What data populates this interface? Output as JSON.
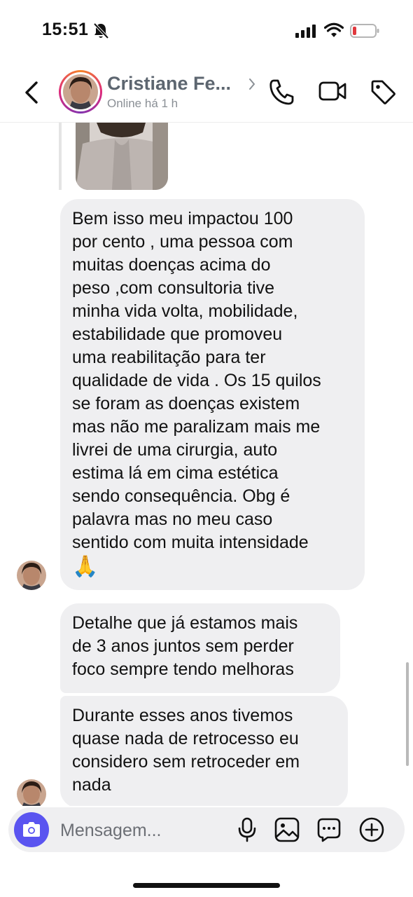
{
  "status_bar": {
    "time": "15:51",
    "icons": [
      "bell-slash-icon",
      "signal-icon",
      "wifi-icon",
      "battery-low-icon"
    ],
    "battery_color": "#e0393e"
  },
  "header": {
    "contact_name": "Cristiane Fe...",
    "status": "Online há 1 h",
    "icons": [
      "back-icon",
      "phone-icon",
      "video-icon",
      "tag-icon"
    ]
  },
  "messages": [
    {
      "text": "Bem isso meu impactou 100\npor cento , uma pessoa com\nmuitas doenças acima do\npeso ,com consultoria tive\nminha vida volta, mobilidade,\nestabilidade que promoveu\numa reabilitação para ter\nqualidade de vida . Os 15 quilos\nse foram as doenças existem\nmas não me paralizam mais me\nlivrei de uma cirurgia, auto\nestima lá em cima estética\nsendo consequência. Obg é\npalavra mas no meu caso\nsentido com muita intensidade",
      "emoji": "🙏"
    },
    {
      "text": "Detalhe que já estamos mais\nde 3 anos juntos sem perder\nfoco sempre tendo melhoras"
    },
    {
      "text": "Durante esses anos tivemos\nquase nada de retrocesso eu\nconsidero sem retroceder em\nnada"
    }
  ],
  "composer": {
    "placeholder": "Mensagem...",
    "accent_color": "#5a54f0",
    "icons": [
      "camera-icon",
      "microphone-icon",
      "gallery-icon",
      "sticker-icon",
      "plus-icon"
    ]
  },
  "colors": {
    "bubble": "#efeff1",
    "name_text": "#5d6670"
  }
}
